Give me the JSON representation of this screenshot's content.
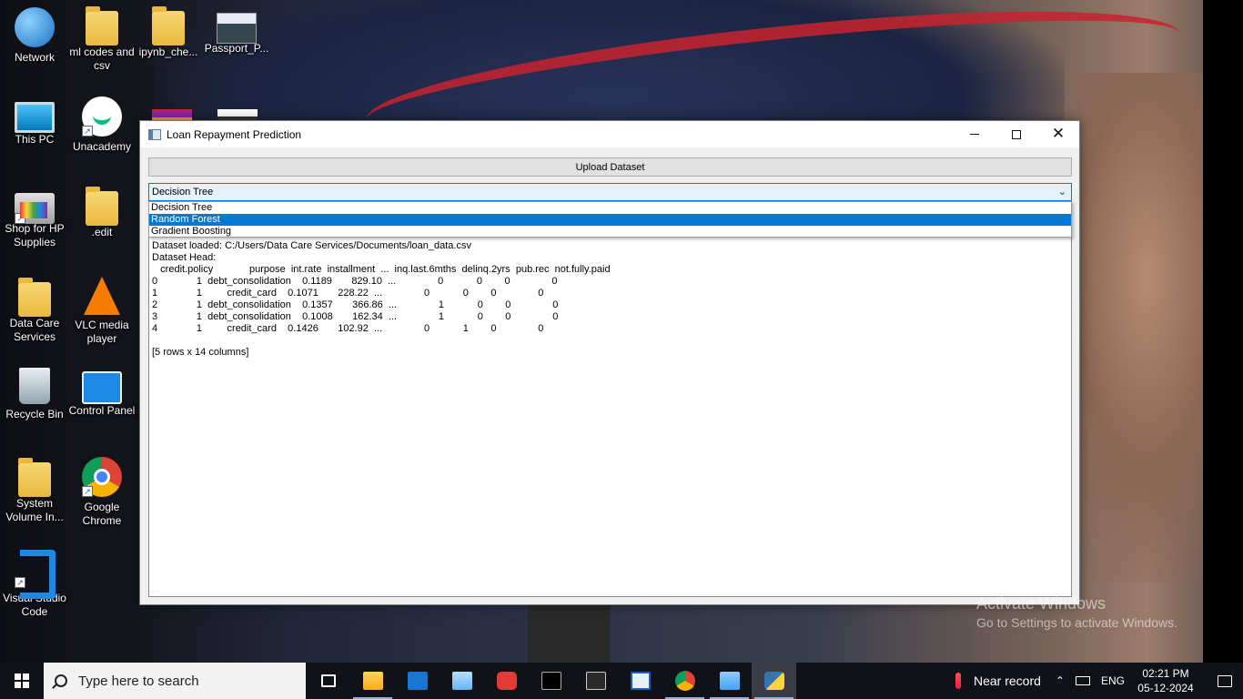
{
  "desktop": {
    "icons": [
      {
        "label": "Network",
        "icon": "network-icon"
      },
      {
        "label": "ml codes and csv",
        "icon": "folder-icon"
      },
      {
        "label": "ipynb_che...",
        "icon": "folder-icon"
      },
      {
        "label": "Passport_P...",
        "icon": "photo-icon"
      },
      {
        "label": "This PC",
        "icon": "pc-icon"
      },
      {
        "label": "Unacademy",
        "icon": "unacademy-icon"
      },
      {
        "label": "Shop for HP Supplies",
        "icon": "printer-icon"
      },
      {
        "label": ".edit",
        "icon": "folder-icon"
      },
      {
        "label": "Data Care Services",
        "icon": "user-folder-icon"
      },
      {
        "label": "VLC media player",
        "icon": "vlc-icon"
      },
      {
        "label": "Recycle Bin",
        "icon": "recycle-bin-icon"
      },
      {
        "label": "Control Panel",
        "icon": "control-panel-icon"
      },
      {
        "label": "System Volume In...",
        "icon": "folder-icon"
      },
      {
        "label": "Google Chrome",
        "icon": "chrome-icon"
      },
      {
        "label": "Visual Studio Code",
        "icon": "vscode-icon"
      }
    ],
    "watermark": {
      "title": "Activate Windows",
      "subtitle": "Go to Settings to activate Windows."
    }
  },
  "window": {
    "title": "Loan Repayment Prediction",
    "upload_button": "Upload Dataset",
    "model_select": {
      "selected": "Decision Tree",
      "options": [
        "Decision Tree",
        "Random Forest",
        "Gradient Boosting"
      ],
      "highlighted": "Random Forest"
    },
    "output_lines": [
      "Dataset loaded: C:/Users/Data Care Services/Documents/loan_data.csv",
      "Dataset Head:",
      "   credit.policy             purpose  int.rate  installment  ...  inq.last.6mths  delinq.2yrs  pub.rec  not.fully.paid",
      "0              1  debt_consolidation    0.1189       829.10  ...               0            0        0               0",
      "1              1         credit_card    0.1071       228.22  ...               0            0        0               0",
      "2              1  debt_consolidation    0.1357       366.86  ...               1            0        0               0",
      "3              1  debt_consolidation    0.1008       162.34  ...               1            0        0               0",
      "4              1         credit_card    0.1426       102.92  ...               0            1        0               0",
      "",
      "[5 rows x 14 columns]"
    ]
  },
  "taskbar": {
    "search_placeholder": "Type here to search",
    "weather": "Near record",
    "language": "ENG",
    "time": "02:21 PM",
    "date": "05-12-2024",
    "apps": [
      "task-view",
      "file-explorer",
      "mail",
      "remote-desktop",
      "youtube",
      "command-prompt",
      "terminal",
      "news",
      "chrome",
      "control-panel",
      "python"
    ]
  }
}
